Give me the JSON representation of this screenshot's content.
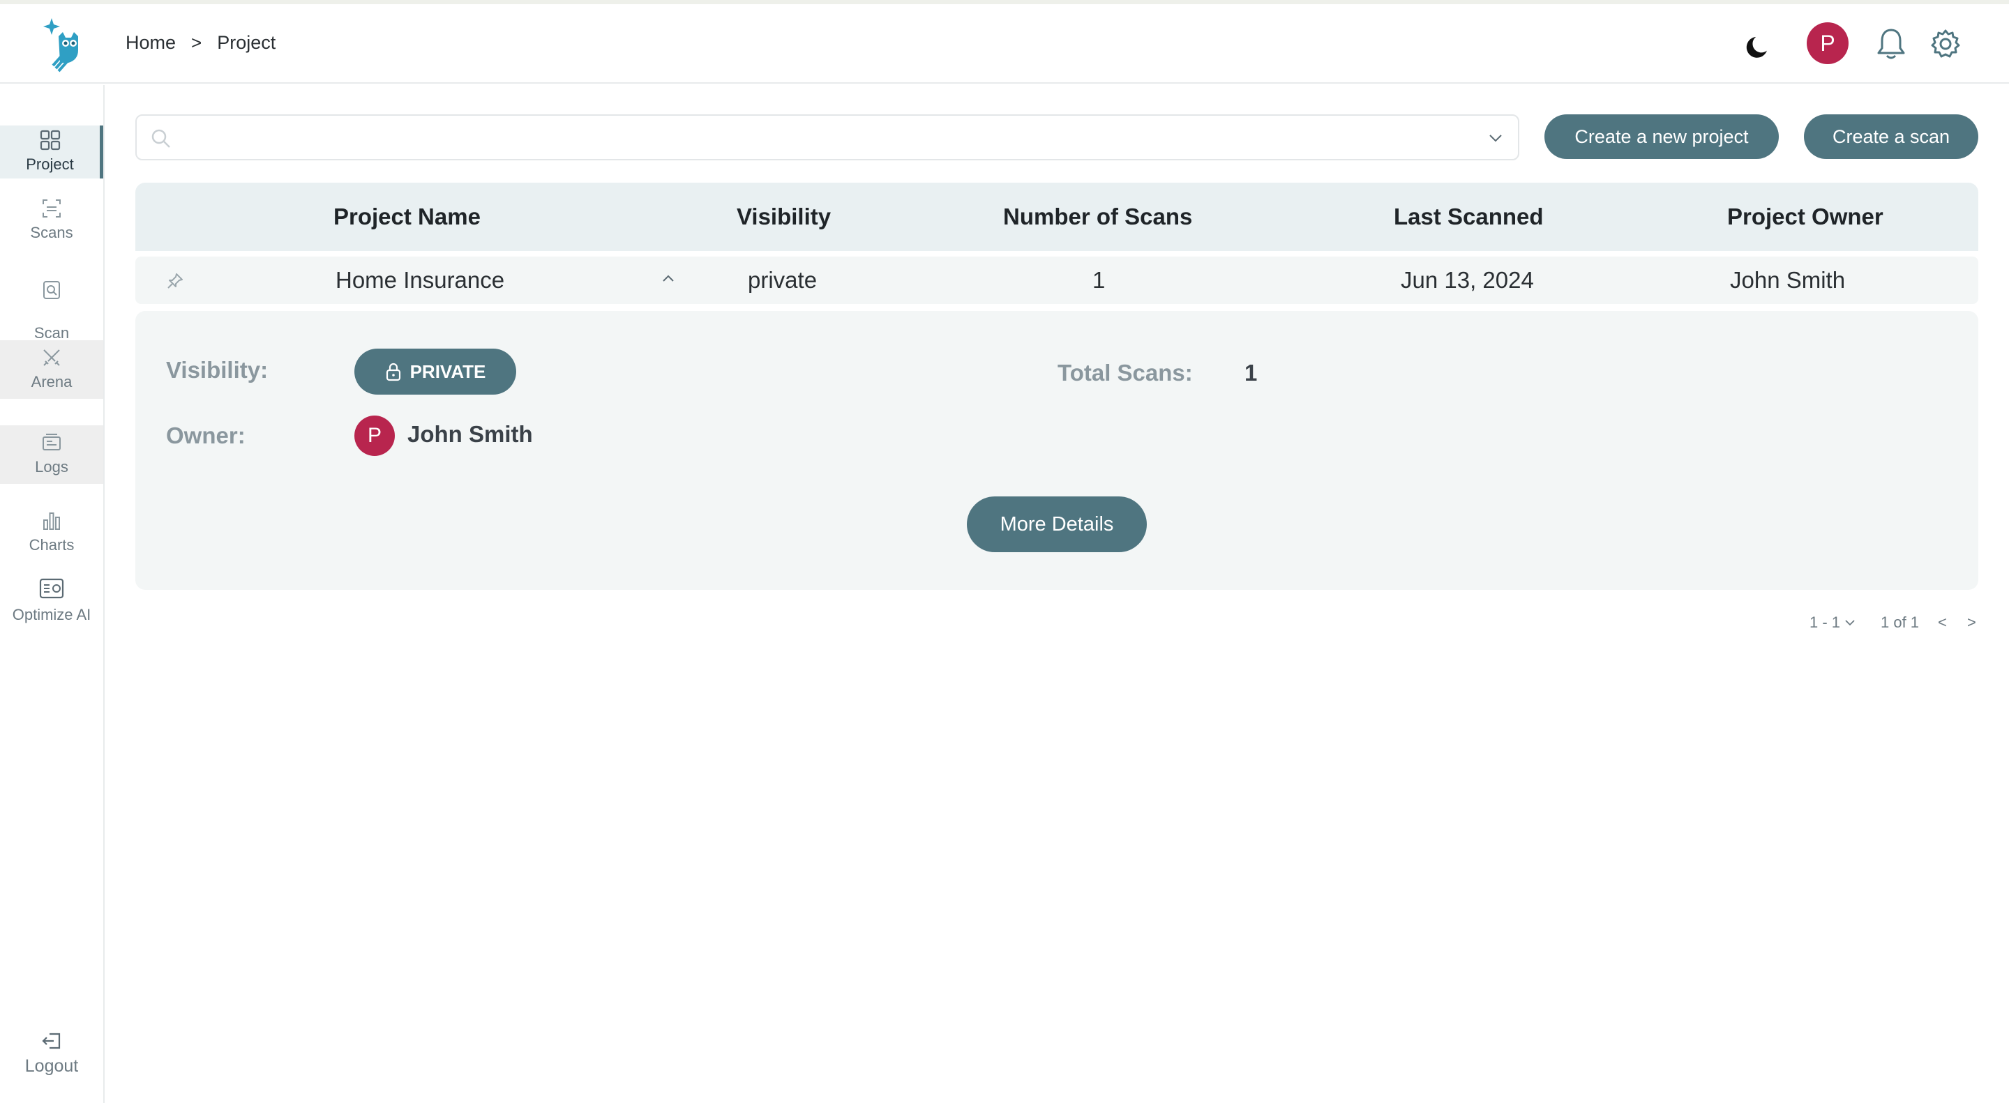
{
  "breadcrumb": {
    "home": "Home",
    "separator": ">",
    "current": "Project"
  },
  "header": {
    "avatar_initial": "P",
    "icons": [
      "moon-icon",
      "bell-icon",
      "gear-icon"
    ]
  },
  "sidebar": {
    "items": [
      {
        "label": "Project",
        "icon": "grid-icon",
        "active": true
      },
      {
        "label": "Scans",
        "icon": "scan-icon"
      },
      {
        "label": "Scan\nSummary",
        "icon": "scan-summary-icon"
      },
      {
        "label": "Arena",
        "icon": "swords-icon"
      },
      {
        "label": "Logs",
        "icon": "logs-icon"
      },
      {
        "label": "Charts",
        "icon": "bar-chart-icon"
      },
      {
        "label": "Optimize AI",
        "icon": "optimize-icon"
      }
    ],
    "logout": "Logout"
  },
  "search": {
    "value": "",
    "placeholder": ""
  },
  "actions": {
    "create_project": "Create a new project",
    "create_scan": "Create a scan"
  },
  "table": {
    "headers": [
      "Project Name",
      "Visibility",
      "Number of Scans",
      "Last Scanned",
      "Project Owner"
    ],
    "rows": [
      {
        "name": "Home Insurance",
        "visibility": "private",
        "scans": "1",
        "last_scanned": "Jun 13, 2024",
        "owner": "John Smith"
      }
    ]
  },
  "detail": {
    "visibility_label": "Visibility:",
    "visibility_badge": "PRIVATE",
    "total_scans_label": "Total Scans:",
    "total_scans_value": "1",
    "owner_label": "Owner:",
    "owner_initial": "P",
    "owner_name": "John Smith",
    "more_details": "More Details"
  },
  "pagination": {
    "range": "1 - 1",
    "page": "1 of 1",
    "prev": "<",
    "next": ">"
  },
  "colors": {
    "accent": "#4f7580",
    "avatar": "#b8254e",
    "header_bg": "#e9f0f2",
    "row_bg": "#f3f6f6"
  }
}
